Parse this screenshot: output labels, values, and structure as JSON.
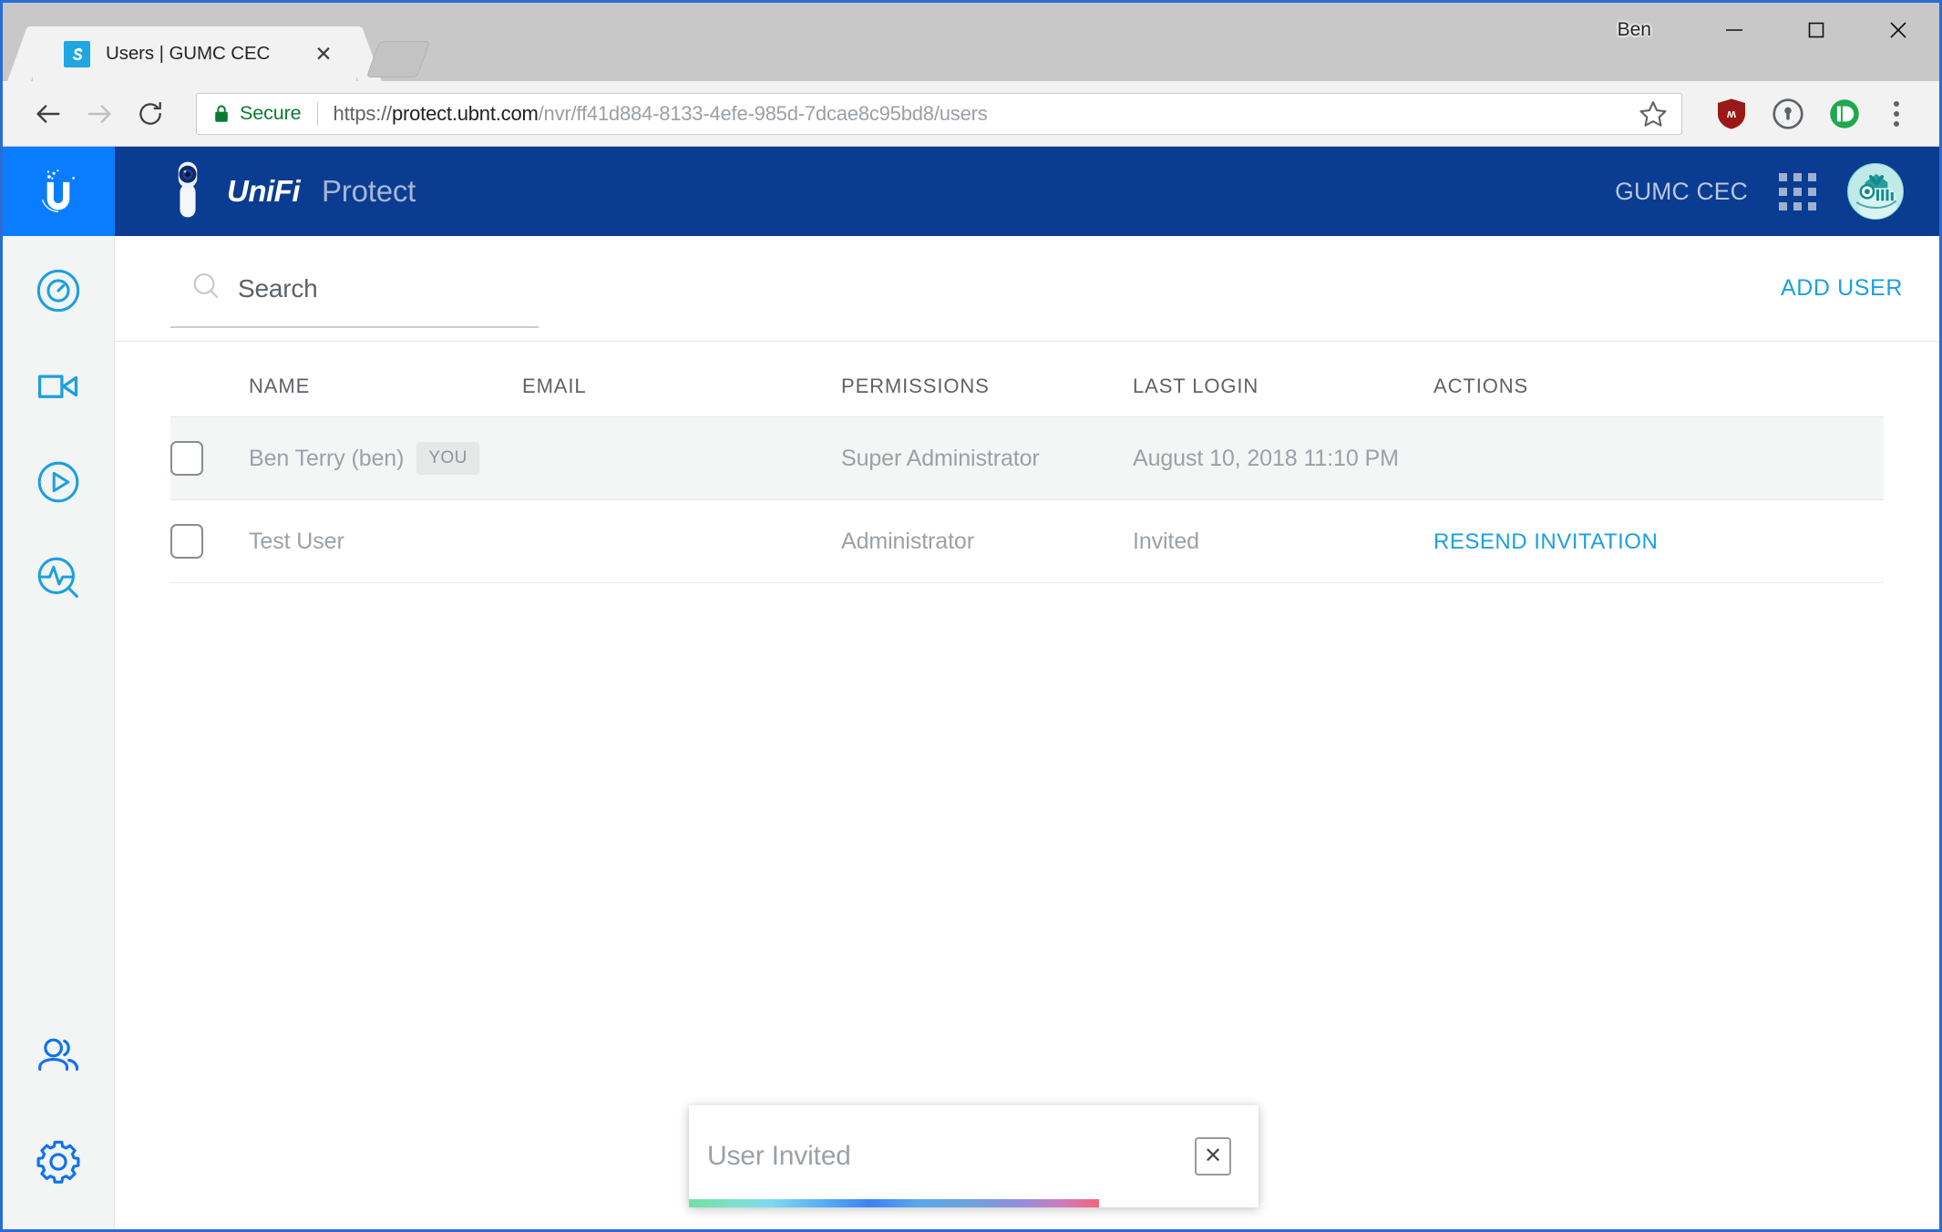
{
  "browser": {
    "tab": {
      "title": "Users | GUMC CEC",
      "favicon_icon": "app-favicon",
      "close_icon": "close-icon"
    },
    "new_tab_label": "",
    "profile_name": "Ben",
    "window_controls": {
      "minimize": "—",
      "maximize": "□",
      "close": "✕"
    },
    "nav": {
      "back_icon": "back-arrow-icon",
      "forward_icon": "forward-arrow-icon",
      "reload_icon": "reload-icon"
    },
    "omnibox": {
      "security_label": "Secure",
      "lock_icon": "lock-icon",
      "url_scheme": "https://",
      "url_domain": "protect.ubnt.com",
      "url_path": "/nvr/ff41d884-8133-4efe-985d-7dcae8c95bd8/users",
      "star_icon": "bookmark-star-icon"
    },
    "extensions": [
      {
        "name": "ublock-origin-icon",
        "color": "#9b1818"
      },
      {
        "name": "onepassword-icon",
        "color": "#5f6368"
      },
      {
        "name": "pushbullet-icon",
        "color": "#21a84f"
      }
    ],
    "menu_icon": "kebab-menu-icon"
  },
  "sidebar": {
    "logo_icon": "ubiquiti-logo-icon",
    "logo_bg": "#0a7cff",
    "items": [
      {
        "id": "dashboard",
        "icon": "lens-circle-icon",
        "label": "Dashboard"
      },
      {
        "id": "cameras",
        "icon": "video-camera-icon",
        "label": "Cameras"
      },
      {
        "id": "playback",
        "icon": "play-circle-icon",
        "label": "Playback"
      },
      {
        "id": "events",
        "icon": "activity-search-icon",
        "label": "Events"
      }
    ],
    "bottom_items": [
      {
        "id": "users",
        "icon": "users-icon",
        "label": "Users"
      },
      {
        "id": "settings",
        "icon": "gear-icon",
        "label": "Settings"
      }
    ]
  },
  "header": {
    "product_icon": "unifi-camera-icon",
    "brand": "UniFi",
    "brand_sub": "Protect",
    "site_name": "GUMC CEC",
    "apps_icon": "app-grid-icon",
    "avatar_icon": "user-avatar",
    "bg": "#0a3c91"
  },
  "toolbar": {
    "search_icon": "search-icon",
    "search_placeholder": "Search",
    "search_value": "",
    "add_user_label": "ADD USER",
    "accent": "#1ba0e0"
  },
  "table": {
    "columns": [
      "NAME",
      "EMAIL",
      "PERMISSIONS",
      "LAST LOGIN",
      "ACTIONS"
    ],
    "rows": [
      {
        "name": "Ben Terry (ben)",
        "badge": "YOU",
        "email": "",
        "permissions": "Super Administrator",
        "last_login": "August 10, 2018 11:10 PM",
        "action": "",
        "selected": false,
        "highlighted": true
      },
      {
        "name": "Test User",
        "badge": "",
        "email": "",
        "permissions": "Administrator",
        "last_login": "Invited",
        "action": "RESEND INVITATION",
        "selected": false,
        "highlighted": false
      }
    ]
  },
  "toast": {
    "message": "User Invited",
    "close_icon": "close-icon",
    "progress_percent": 72
  }
}
